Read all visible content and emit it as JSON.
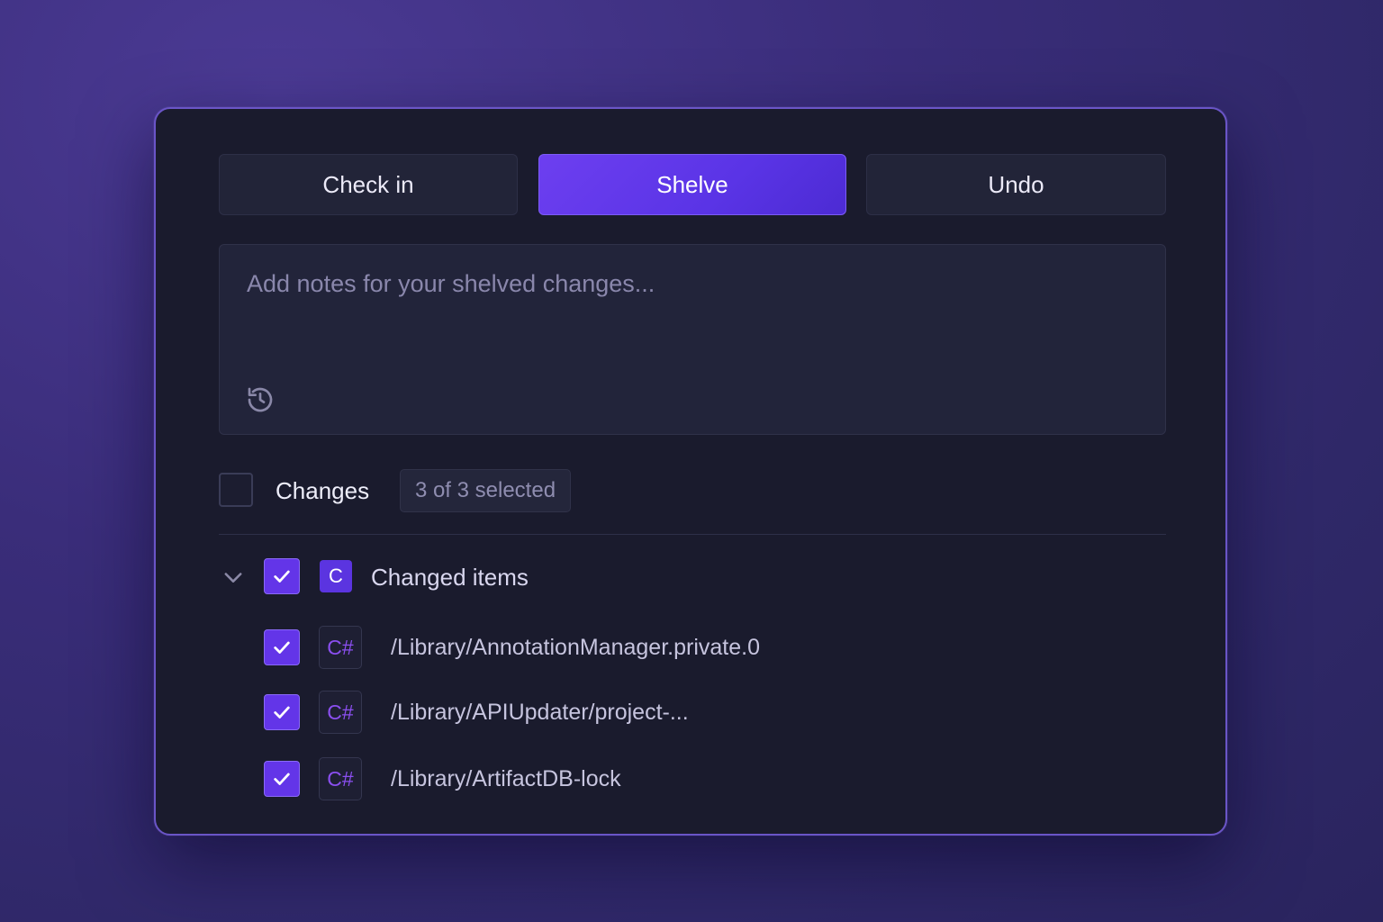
{
  "toolbar": {
    "check_in_label": "Check in",
    "shelve_label": "Shelve",
    "undo_label": "Undo"
  },
  "notes": {
    "placeholder": "Add notes for your shelved changes...",
    "value": "",
    "history_icon": "history-icon"
  },
  "changes": {
    "label": "Changes",
    "selected_badge": "3 of 3 selected",
    "all_checked": false
  },
  "group": {
    "expanded": true,
    "checked": true,
    "badge": "C",
    "label": "Changed items"
  },
  "files": [
    {
      "checked": true,
      "type_badge": "C#",
      "path": "/Library/AnnotationManager.private.0"
    },
    {
      "checked": true,
      "type_badge": "C#",
      "path": "/Library/APIUpdater/project-..."
    },
    {
      "checked": true,
      "type_badge": "C#",
      "path": "/Library/ArtifactDB-lock"
    }
  ],
  "colors": {
    "accent": "#6335e8",
    "panel_background": "#1a1b2d",
    "panel_border": "#6a55c7",
    "csharp_badge_text": "#8b4ff0"
  }
}
